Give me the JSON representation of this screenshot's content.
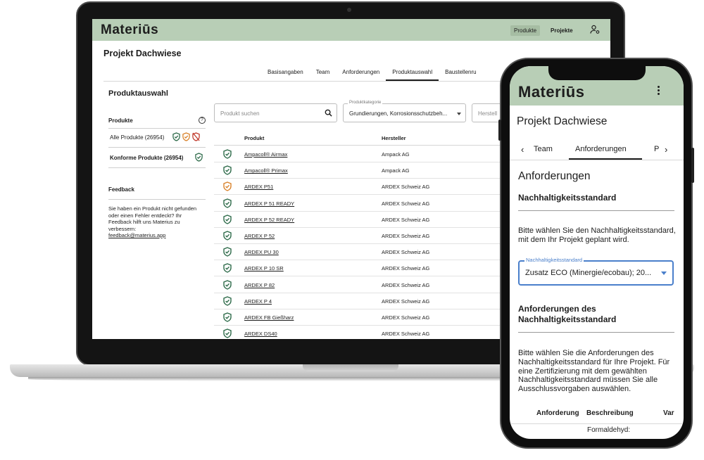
{
  "laptop": {
    "app": {
      "logo": "Materiūs",
      "nav_produkte": "Produkte",
      "nav_projekte": "Projekte",
      "user_icon": "user-settings-icon"
    },
    "project_title": "Projekt Dachwiese",
    "tabs": [
      {
        "label": "Basisangaben",
        "active": false
      },
      {
        "label": "Team",
        "active": false
      },
      {
        "label": "Anforderungen",
        "active": false
      },
      {
        "label": "Produktauswahl",
        "active": true
      },
      {
        "label": "Baustellenru",
        "active": false
      }
    ],
    "section_title": "Produktauswahl",
    "left_panel": {
      "produkte_label": "Produkte",
      "help_icon": "question-circle-icon",
      "items": [
        {
          "label": "Alle Produkte (26954)",
          "bold": false,
          "shields": [
            "green",
            "orange",
            "red"
          ]
        },
        {
          "label": "Konforme Produkte (26954)",
          "bold": true,
          "shields": [
            "green"
          ]
        }
      ],
      "feedback_label": "Feedback",
      "feedback_text": "Sie haben ein Produkt nicht gefunden oder einen Fehler entdeckt? Ihr Feedback hilft uns Materius zu verbessern:",
      "feedback_email": "feedback@materius.app"
    },
    "search": {
      "placeholder": "Produkt suchen",
      "icon": "search-icon"
    },
    "category": {
      "label": "Produktkategorie",
      "value": "Grundierungen, Korrosionsschutzbeh..."
    },
    "manufacturer_filter": {
      "placeholder": "Herstell"
    },
    "table": {
      "headers": {
        "product": "Produkt",
        "manufacturer": "Hersteller"
      },
      "rows": [
        {
          "product": "Ampacoll® Airmax",
          "manufacturer": "Ampack AG",
          "status": "green"
        },
        {
          "product": "Ampacoll® Primax",
          "manufacturer": "Ampack AG",
          "status": "green"
        },
        {
          "product": "ARDEX P51",
          "manufacturer": "ARDEX Schweiz AG",
          "status": "orange"
        },
        {
          "product": "ARDEX P 51 READY",
          "manufacturer": "ARDEX Schweiz AG",
          "status": "green"
        },
        {
          "product": "ARDEX P 52 READY",
          "manufacturer": "ARDEX Schweiz AG",
          "status": "green"
        },
        {
          "product": "ARDEX P 52",
          "manufacturer": "ARDEX Schweiz AG",
          "status": "green"
        },
        {
          "product": "ARDEX PU 30",
          "manufacturer": "ARDEX Schweiz AG",
          "status": "green"
        },
        {
          "product": "ARDEX P 10 SR",
          "manufacturer": "ARDEX Schweiz AG",
          "status": "green"
        },
        {
          "product": "ARDEX P 82",
          "manufacturer": "ARDEX Schweiz AG",
          "status": "green"
        },
        {
          "product": "ARDEX P 4",
          "manufacturer": "ARDEX Schweiz AG",
          "status": "green"
        },
        {
          "product": "ARDEX FB Gießharz",
          "manufacturer": "ARDEX Schweiz AG",
          "status": "green"
        },
        {
          "product": "ARDEX DS40",
          "manufacturer": "ARDEX Schweiz AG",
          "status": "green"
        }
      ]
    }
  },
  "phone": {
    "logo": "Materiūs",
    "menu_icon": "more-vertical-icon",
    "project_title": "Projekt Dachwiese",
    "tabs": {
      "prev": "Team",
      "active": "Anforderungen",
      "next": "P"
    },
    "heading": "Anforderungen",
    "sub1": "Nachhaltigkeitsstandard",
    "para1": "Bitte wählen Sie den Nachhaltigkeitsstandard, mit dem Ihr Projekt geplant wird.",
    "select": {
      "label": "Nachhaltigkeitsstandard",
      "value": "Zusatz ECO (Minergie/ecobau); 20..."
    },
    "sub2": "Anforderungen des Nachhaltigkeitsstandard",
    "para2": "Bitte wählen Sie die Anforderungen des Nachhaltigkeitsstandard für Ihre Projekt. Für eine Zertifizierung mit dem gewählten Nachhaltigkeitsstandard müssen Sie alle Ausschlussvorgaben auswählen.",
    "table_headers": {
      "col1": "Anforderung",
      "col2": "Beschreibung",
      "col3": "Var"
    },
    "first_cell": "Formaldehyd:"
  },
  "colors": {
    "brand_green": "#b8ceb6",
    "shield_green": "#2e6b4a",
    "shield_orange": "#d9822b",
    "shield_red": "#c0392b",
    "focus_blue": "#4a7fcb"
  }
}
